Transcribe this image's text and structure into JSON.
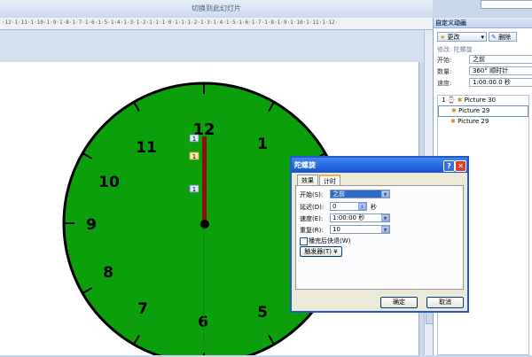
{
  "top_bar": {
    "title": "切换到此幻灯片"
  },
  "ruler": {
    "text": "·12·1·11·1·10·1·9·1·8·1·7·1·6·1·5·1·4·1·3·1·2·1·1·1·0·1·1·1·2·1·3·1·4·1·5·1·6·1·7·1·8·1·9·1·10·1·11·1·12·"
  },
  "clock": {
    "numbers": [
      "12",
      "1",
      "11",
      "10",
      "9",
      "8",
      "7",
      "6",
      "5"
    ],
    "face_color": "#0c9f0c",
    "hand_color": "#8a1010",
    "tags": [
      "1",
      "1",
      "1"
    ]
  },
  "panel": {
    "title": "自定义动画",
    "change_label": "更改",
    "delete_label": "删除",
    "modify_label": "修改: 陀螺旋",
    "start_label": "开始:",
    "start_value": "之前",
    "amount_label": "数量:",
    "amount_value": "360° 顺时针",
    "speed_label": "速度:",
    "speed_value": "1:00:00.0 秒",
    "list": [
      {
        "num": "1",
        "name": "Picture 30"
      },
      {
        "num": "",
        "name": "Picture 29"
      },
      {
        "num": "",
        "name": "Picture 29"
      }
    ]
  },
  "dialog": {
    "title": "陀螺旋",
    "tabs": [
      "效果",
      "计时"
    ],
    "start_label": "开始(S):",
    "start_value": "之前",
    "delay_label": "延迟(D):",
    "delay_value": "0",
    "delay_unit": "秒",
    "speed_label": "速度(E):",
    "speed_value": "1:00:00 秒",
    "repeat_label": "重复(R):",
    "repeat_value": "10",
    "rewind_label": "播完后快退(W)",
    "trigger_label": "触发器(T) ¥",
    "ok_label": "确定",
    "cancel_label": "取消"
  }
}
